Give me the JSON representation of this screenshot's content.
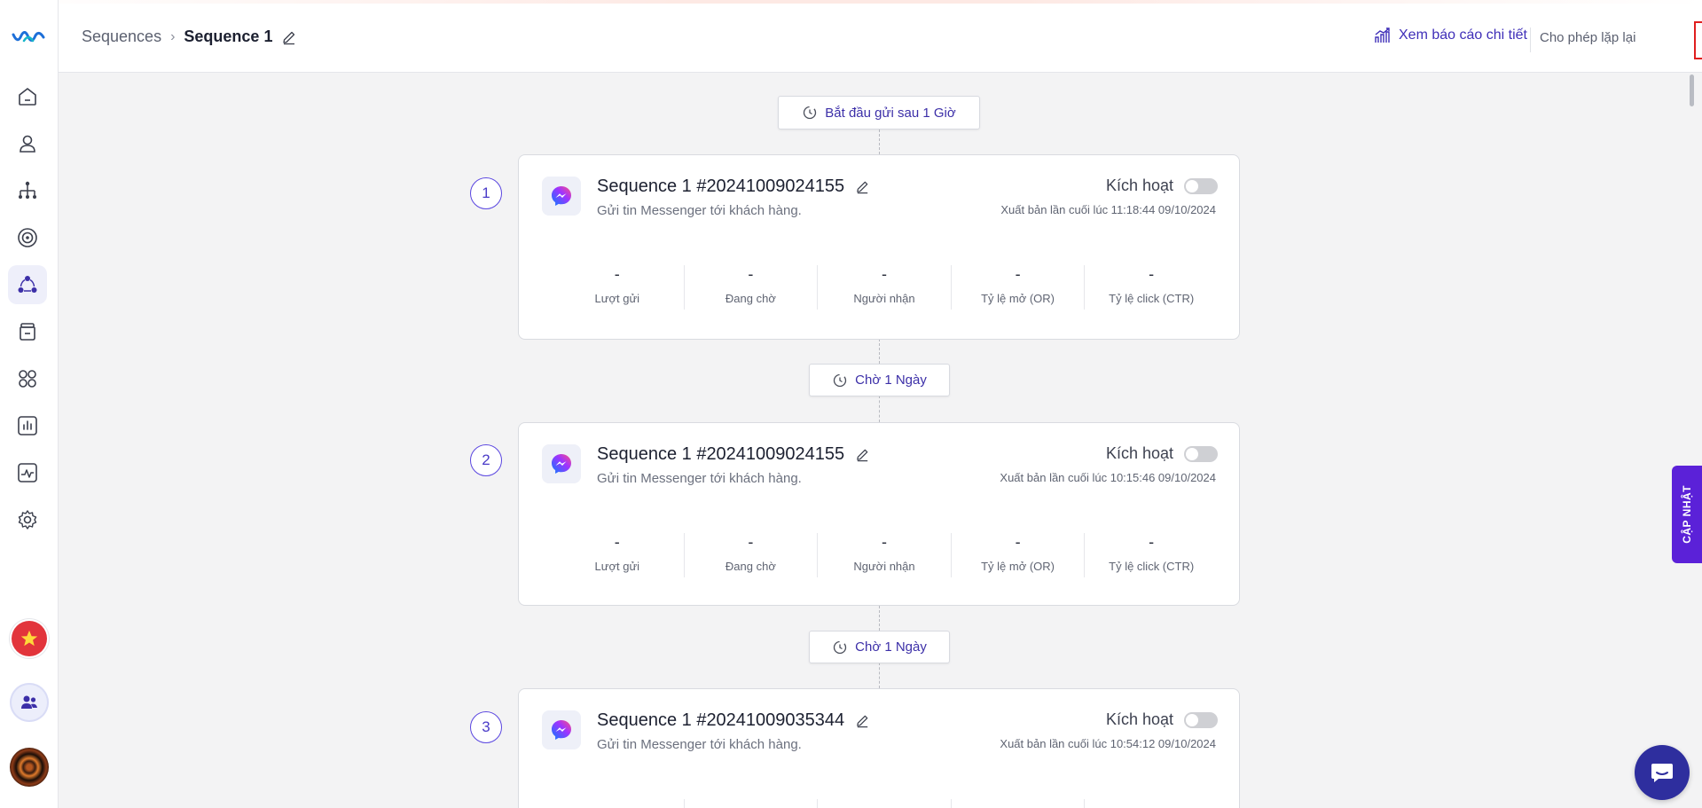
{
  "header": {
    "breadcrumb_parent": "Sequences",
    "breadcrumb_current": "Sequence 1",
    "report_link": "Xem báo cáo chi tiết",
    "repeat_label": "Cho phép lặp lại",
    "repeat_enabled": false
  },
  "sidebar": {
    "items": [
      {
        "icon": "home-icon"
      },
      {
        "icon": "user-icon"
      },
      {
        "icon": "org-tree-icon"
      },
      {
        "icon": "broadcast-icon"
      },
      {
        "icon": "sequence-icon",
        "active": true
      },
      {
        "icon": "jar-icon"
      },
      {
        "icon": "apps-icon"
      },
      {
        "icon": "bar-chart-icon"
      },
      {
        "icon": "activity-icon"
      },
      {
        "icon": "gear-icon"
      }
    ]
  },
  "flow": {
    "start_pill": "Bắt đầu gửi sau 1 Giờ",
    "wait_pills": [
      "Chờ 1 Ngày",
      "Chờ 1 Ngày"
    ],
    "activate_label": "Kích hoạt",
    "stat_labels": [
      "Lượt gửi",
      "Đang chờ",
      "Người nhận",
      "Tỷ lệ mở (OR)",
      "Tỷ lệ click (CTR)"
    ],
    "steps": [
      {
        "number": "1",
        "title": "Sequence 1 #20241009024155",
        "description": "Gửi tin Messenger tới khách hàng.",
        "published": "Xuất bản lần cuối lúc 11:18:44 09/10/2024",
        "active": false,
        "stats": [
          "-",
          "-",
          "-",
          "-",
          "-"
        ]
      },
      {
        "number": "2",
        "title": "Sequence 1 #20241009024155",
        "description": "Gửi tin Messenger tới khách hàng.",
        "published": "Xuất bản lần cuối lúc 10:15:46 09/10/2024",
        "active": false,
        "stats": [
          "-",
          "-",
          "-",
          "-",
          "-"
        ]
      },
      {
        "number": "3",
        "title": "Sequence 1 #20241009035344",
        "description": "Gửi tin Messenger tới khách hàng.",
        "published": "Xuất bản lần cuối lúc 10:54:12 09/10/2024",
        "active": false,
        "stats": [
          "-",
          "-",
          "-",
          "-",
          "-"
        ]
      }
    ]
  },
  "update_tab": "CẬP NHẬT",
  "colors": {
    "accent": "#3f2fb8",
    "update_tab": "#5b21d8",
    "chat": "#2e2e9e",
    "highlight_box": "#e01e1e"
  }
}
